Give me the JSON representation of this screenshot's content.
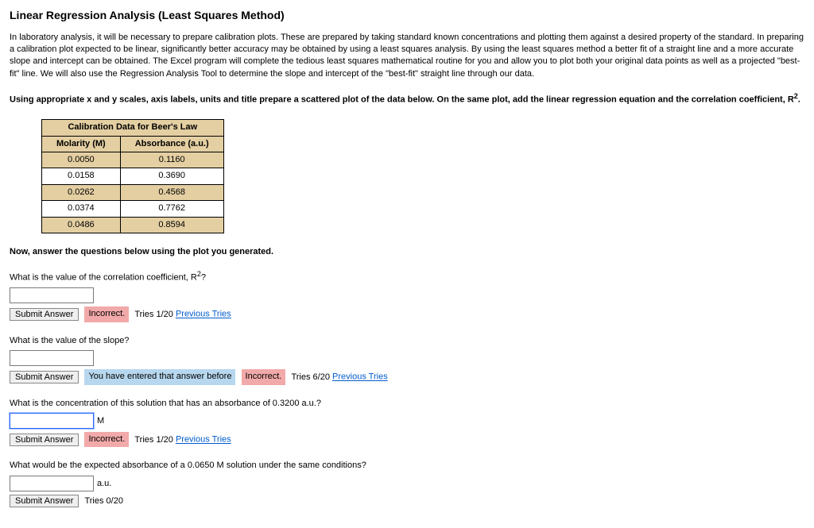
{
  "title": "Linear Regression Analysis (Least Squares Method)",
  "paragraph": "In laboratory analysis, it will be necessary to prepare calibration plots. These are prepared by taking standard known concentrations and plotting them against a desired property of the standard. In preparing a calibration plot expected to be linear, significantly better accuracy may be obtained by using a least squares analysis. By using the least squares method a better fit of a straight line and a more accurate slope and intercept can be obtained. The Excel program will complete the tedious least squares mathematical routine for you and allow you to plot both your original data points as well as a projected \"best-fit\" line. We will also use the Regression Analysis Tool to determine the slope and intercept of the \"best-fit\" straight line through our data.",
  "instruction_prefix": "Using appropriate x and y scales, axis labels, units and title prepare a scattered plot of the data below. On the same plot, add the linear regression equation and the correlation coefficient, R",
  "instruction_suffix": ".",
  "table": {
    "title": "Calibration Data for Beer's Law",
    "col1": "Molarity (M)",
    "col2": "Absorbance (a.u.)",
    "rows": [
      {
        "m": "0.0050",
        "a": "0.1160"
      },
      {
        "m": "0.0158",
        "a": "0.3690"
      },
      {
        "m": "0.0262",
        "a": "0.4568"
      },
      {
        "m": "0.0374",
        "a": "0.7762"
      },
      {
        "m": "0.0486",
        "a": "0.8594"
      }
    ]
  },
  "subhead": "Now, answer the questions below using the plot you generated.",
  "q1": {
    "text_prefix": "What is the value of the correlation coefficient, R",
    "text_suffix": "?",
    "submit": "Submit Answer",
    "status": "Incorrect.",
    "tries": "Tries 1/20",
    "prev": "Previous Tries"
  },
  "q2": {
    "text": "What is the value of the slope?",
    "submit": "Submit Answer",
    "status_prev": "You have entered that answer before",
    "status_incorrect": "Incorrect.",
    "tries": "Tries 6/20",
    "prev": "Previous Tries"
  },
  "q3": {
    "text": "What is the concentration of this solution that has an absorbance of 0.3200 a.u.?",
    "unit": "M",
    "submit": "Submit Answer",
    "status": "Incorrect.",
    "tries": "Tries 1/20",
    "prev": "Previous Tries"
  },
  "q4": {
    "text": "What would be the expected absorbance of a 0.0650 M solution under the same conditions?",
    "unit": "a.u.",
    "submit": "Submit Answer",
    "tries": "Tries 0/20"
  }
}
